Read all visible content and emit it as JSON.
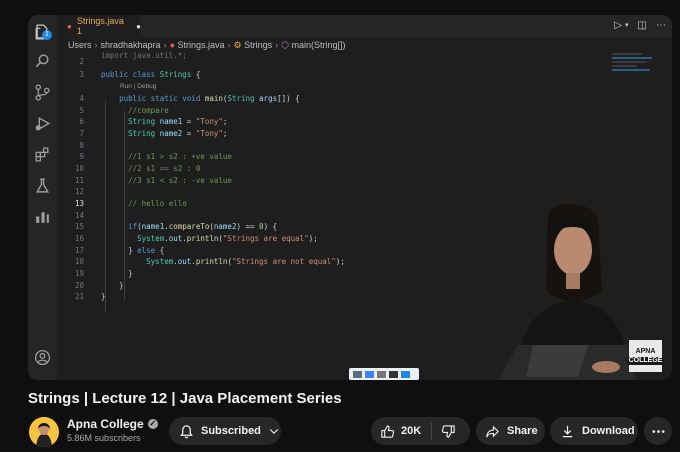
{
  "editor": {
    "tab_label": "Strings.java 1",
    "breadcrumbs": [
      "Users",
      "shradhakhapra",
      "Strings.java",
      "Strings",
      "main(String[])"
    ],
    "codelens": "Run | Debug",
    "lines": [
      {
        "num": "2",
        "text": "import java.util.*;"
      },
      {
        "num": "3",
        "text": "public class Strings {"
      },
      {
        "num": "4",
        "text": "    public static void main(String args[]) {"
      },
      {
        "num": "5",
        "text": "      //compare"
      },
      {
        "num": "6",
        "text": "      String name1 = \"Tony\";"
      },
      {
        "num": "7",
        "text": "      String name2 = \"Tony\";"
      },
      {
        "num": "8",
        "text": ""
      },
      {
        "num": "9",
        "text": "      //1 s1 > s2 : +ve value"
      },
      {
        "num": "10",
        "text": "      //2 s1 == s2 : 0"
      },
      {
        "num": "11",
        "text": "      //3 s1 < s2 : -ve value"
      },
      {
        "num": "12",
        "text": ""
      },
      {
        "num": "13",
        "text": "      // hello ello"
      },
      {
        "num": "14",
        "text": ""
      },
      {
        "num": "15",
        "text": "      if(name1.compareTo(name2) == 0) {"
      },
      {
        "num": "16",
        "text": "        System.out.println(\"Strings are equal\");"
      },
      {
        "num": "17",
        "text": "      } else {"
      },
      {
        "num": "18",
        "text": "          System.out.println(\"Strings are not equal\");"
      },
      {
        "num": "19",
        "text": "      }"
      },
      {
        "num": "20",
        "text": "    }"
      },
      {
        "num": "21",
        "text": "}"
      }
    ]
  },
  "watermark": {
    "line1": "APNA",
    "line2": "COLLEGE"
  },
  "video": {
    "title": "Strings | Lecture 12 | Java Placement Series"
  },
  "channel": {
    "name": "Apna College",
    "subscribers": "5.86M subscribers"
  },
  "actions": {
    "subscribed": "Subscribed",
    "likes": "20K",
    "share": "Share",
    "download": "Download"
  },
  "colors": {
    "background": "#0f0f0f",
    "editor": "#1e1e1e",
    "pill": "#272727",
    "keyword": "#569cd6",
    "string": "#ce9178",
    "comment": "#6a9955"
  }
}
